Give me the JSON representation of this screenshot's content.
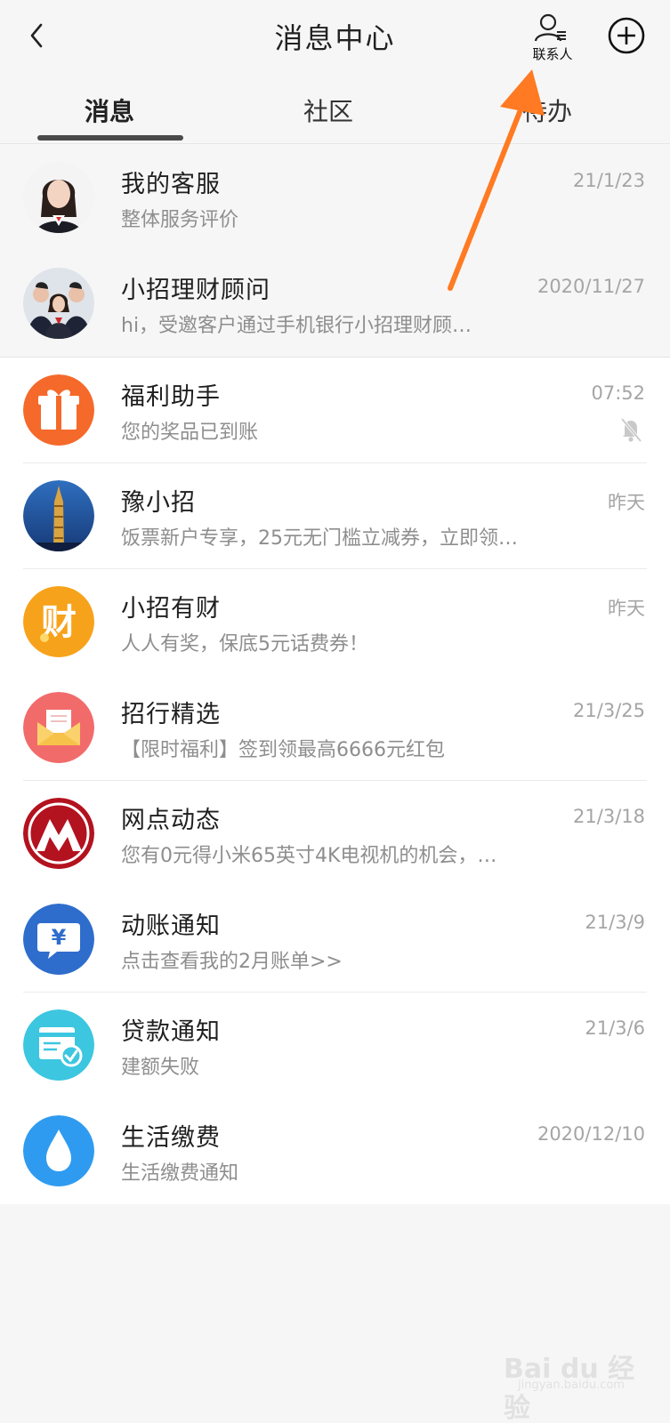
{
  "header": {
    "title": "消息中心",
    "contacts_label": "联系人"
  },
  "tabs": [
    {
      "label": "消息",
      "active": true
    },
    {
      "label": "社区",
      "active": false
    },
    {
      "label": "待办",
      "active": false
    }
  ],
  "messages": [
    {
      "name": "我的客服",
      "preview": "整体服务评价",
      "time": "21/1/23",
      "pinned": true,
      "icon": "customer-service-avatar"
    },
    {
      "name": "小招理财顾问",
      "preview": "hi，受邀客户通过手机银行小招理财顾…",
      "time": "2020/11/27",
      "pinned": true,
      "icon": "advisor-team-avatar"
    },
    {
      "name": "福利助手",
      "preview": "您的奖品已到账",
      "time": "07:52",
      "muted": true,
      "icon": "gift-icon",
      "color": "#f5692a"
    },
    {
      "name": "豫小招",
      "preview": "饭票新户专享，25元无门槛立减券，立即领…",
      "time": "昨天",
      "icon": "tower-photo-avatar"
    },
    {
      "name": "小招有财",
      "preview": "人人有奖，保底5元话费券！",
      "time": "昨天",
      "icon": "cai-icon",
      "color": "#f7a21b",
      "glyph": "财"
    },
    {
      "name": "招行精选",
      "preview": "【限时福利】签到领最高6666元红包",
      "time": "21/3/25",
      "icon": "envelope-icon",
      "color": "#f26b6b"
    },
    {
      "name": "网点动态",
      "preview": "您有0元得小米65英寸4K电视机的机会，…",
      "time": "21/3/18",
      "icon": "cmb-logo-icon",
      "color": "#b3121f"
    },
    {
      "name": "动账通知",
      "preview": "点击查看我的2月账单>>",
      "time": "21/3/9",
      "icon": "yuan-bubble-icon",
      "color": "#2f6dcc"
    },
    {
      "name": "贷款通知",
      "preview": "建额失败",
      "time": "21/3/6",
      "icon": "loan-card-icon",
      "color": "#3cc6e0"
    },
    {
      "name": "生活缴费",
      "preview": "生活缴费通知",
      "time": "2020/12/10",
      "icon": "water-drop-icon",
      "color": "#2f9bf0"
    }
  ],
  "watermark": {
    "text": "Bai du 经验",
    "sub": "jingyan.baidu.com"
  },
  "colors": {
    "annotation_arrow": "#ff7a22",
    "background": "#f6f6f6"
  }
}
